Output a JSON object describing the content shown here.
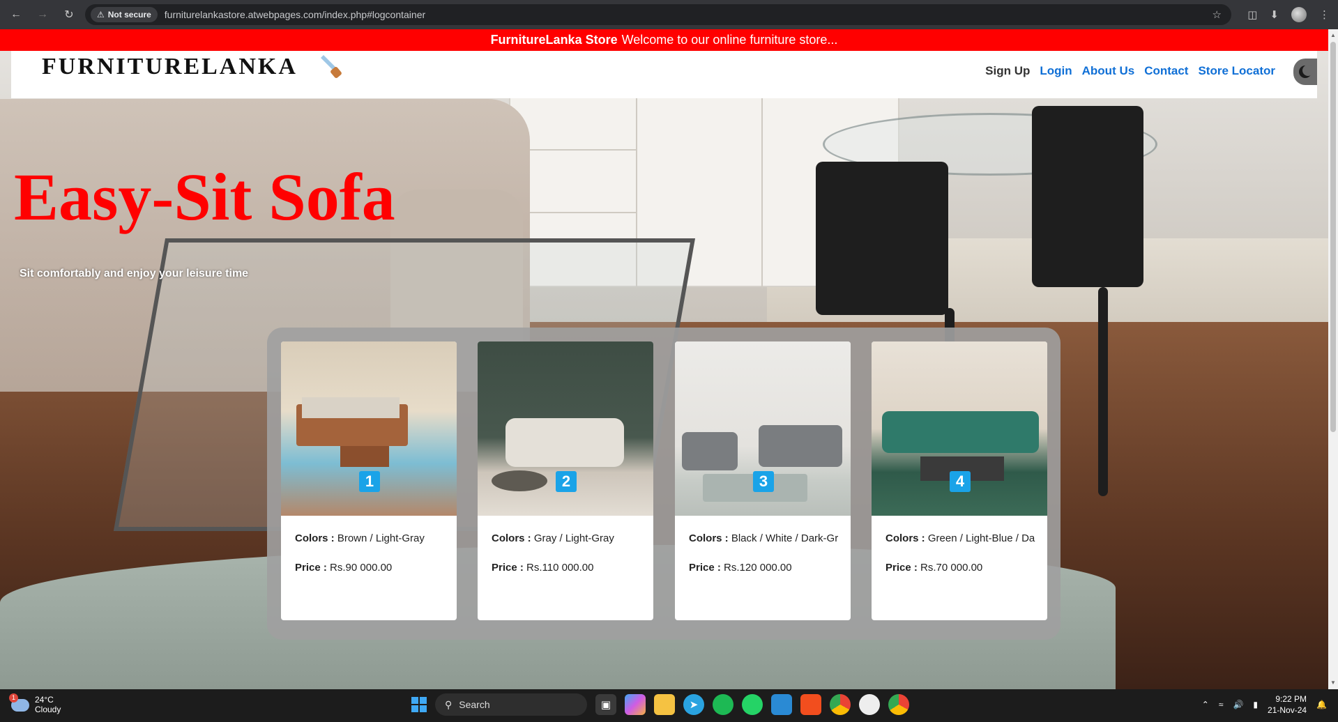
{
  "browser": {
    "security_badge": "Not secure",
    "url": "furniturelankastore.atwebpages.com/index.php#logcontainer"
  },
  "banner": {
    "brand": "FurnitureLanka Store",
    "message": "Welcome to our online furniture store..."
  },
  "navbar": {
    "logo": "FURNITURELANKA",
    "links": [
      "Sign Up",
      "Login",
      "About Us",
      "Contact",
      "Store Locator"
    ]
  },
  "hero": {
    "title": "Easy-Sit Sofa",
    "subtitle": "Sit comfortably and enjoy your leisure time"
  },
  "products": [
    {
      "number": "1",
      "colors_label": "Colors :",
      "colors": "Brown / Light-Gray",
      "price_label": "Price :",
      "price": "Rs.90 000.00"
    },
    {
      "number": "2",
      "colors_label": "Colors :",
      "colors": "Gray / Light-Gray",
      "price_label": "Price :",
      "price": "Rs.110 000.00"
    },
    {
      "number": "3",
      "colors_label": "Colors :",
      "colors": "Black / White / Dark-Gr",
      "price_label": "Price :",
      "price": "Rs.120 000.00"
    },
    {
      "number": "4",
      "colors_label": "Colors :",
      "colors": "Green / Light-Blue / Da",
      "price_label": "Price :",
      "price": "Rs.70 000.00"
    }
  ],
  "taskbar": {
    "weather_temp": "24°C",
    "weather_desc": "Cloudy",
    "weather_badge": "1",
    "search_label": "Search",
    "time": "9:22 PM",
    "date": "21-Nov-24"
  },
  "colors": {
    "banner_bg": "#ff0000",
    "hero_title": "#ff0000",
    "nav_link": "#0f6fd6",
    "badge": "#1aa3e8"
  }
}
